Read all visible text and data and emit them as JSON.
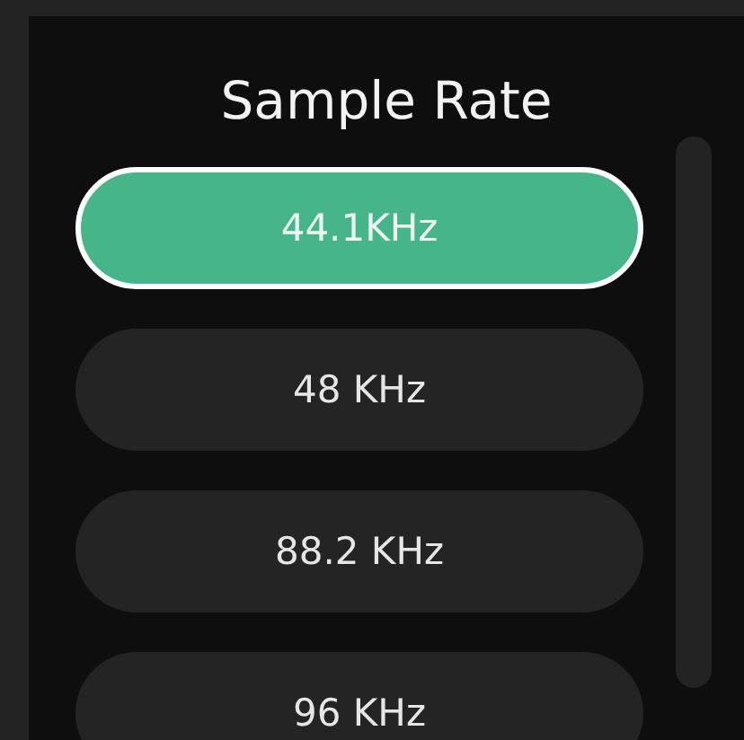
{
  "title": "Sample Rate",
  "options": [
    {
      "label": "44.1KHz",
      "selected": true
    },
    {
      "label": "48 KHz",
      "selected": false
    },
    {
      "label": "88.2 KHz",
      "selected": false
    },
    {
      "label": "96 KHz",
      "selected": false
    }
  ]
}
